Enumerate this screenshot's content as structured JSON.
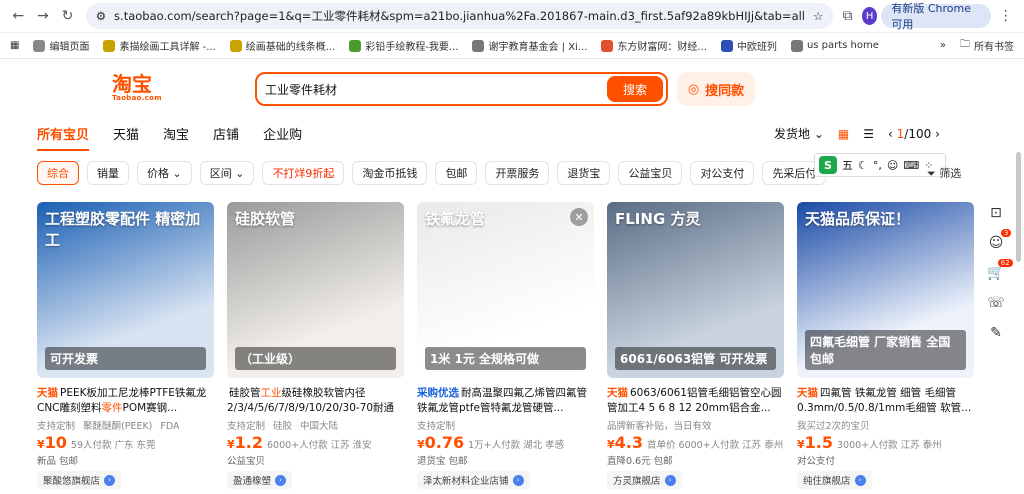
{
  "browser": {
    "url": "s.taobao.com/search?page=1&q=工业零件耗材&spm=a21bo.jianhua%2Fa.201867-main.d3_first.5af92a89kbHIJj&tab=all",
    "avatar_letter": "H",
    "update_label": "有新版 Chrome 可用"
  },
  "bookmarks": [
    "编辑页面",
    "素描绘画工具详解 -...",
    "绘画基础的线条概...",
    "彩铅手绘教程-我要...",
    "谢宇教育基金会 | Xi...",
    "东方财富网：财经...",
    "中欧班列",
    "us parts home"
  ],
  "bookmark_more": "»",
  "bookmark_folder": "所有书签",
  "logo": {
    "cn": "淘宝",
    "en": "Taobao.com"
  },
  "search": {
    "query": "工业零件耗材",
    "button": "搜索",
    "same_pic": "搜同款"
  },
  "tabs": [
    "所有宝贝",
    "天猫",
    "淘宝",
    "店铺",
    "企业购"
  ],
  "tools": {
    "ship_from": "发货地",
    "page": "1",
    "pages": "/100"
  },
  "filters": [
    "综合",
    "销量",
    "价格",
    "区间",
    "不打烊9折起",
    "淘金币抵钱",
    "包邮",
    "开票服务",
    "退货宝",
    "公益宝贝",
    "对公支付",
    "先采后付"
  ],
  "filter_more": "筛选",
  "ime_label": "五",
  "products": [
    {
      "img_text": "工程塑胶零配件 精密加工",
      "img_sub": "可开发票",
      "tag": "天猫",
      "title_a": "PEEK板加工尼龙棒PTFE铁氟龙CNC雕刻塑料",
      "title_hl": "零件",
      "title_b": "POM赛钢...",
      "attrs": [
        "支持定制",
        "聚醚醚酮(PEEK)",
        "FDA"
      ],
      "price": "10",
      "pmeta": "59人付款  广东 东莞",
      "extra": "新品  包邮",
      "shop": "聚酸悠旗舰店",
      "colors": [
        "#1a5fb4",
        "#d9e4f2"
      ]
    },
    {
      "img_text": "硅胶软管",
      "img_sub": "（工业级）",
      "tag": "",
      "title_a": "硅胶管",
      "title_hl": "工业",
      "title_b": "级硅橡胶软管内径2/3/4/5/6/7/8/9/10/20/30-70耐通牌",
      "attrs": [
        "支持定制",
        "硅胶",
        "中国大陆"
      ],
      "price": "1.2",
      "pmeta": "6000+人付款  江苏 淮安",
      "extra": "公益宝贝",
      "shop": "盈通橡塑",
      "colors": [
        "#9a9a9a",
        "#f2efea"
      ]
    },
    {
      "img_text": "铁氟龙管",
      "img_sub": "1米 1元 全规格可做",
      "tag": "采购优选",
      "title_a": "耐高温聚四氟乙烯管四氟管铁氟龙管ptfe管特氟龙管硬管...",
      "title_hl": "",
      "title_b": "",
      "attrs": [
        "支持定制"
      ],
      "price": "0.76",
      "pmeta": "1万+人付款  湖北 孝感",
      "extra": "退货宝  包邮",
      "shop": "泽太新材料企业店铺",
      "colors": [
        "#e9e9e9",
        "#ffffff"
      ]
    },
    {
      "img_text": "FLING 方灵",
      "img_sub": "6061/6063铝管 可开发票",
      "tag": "天猫",
      "title_a": "6063/6061铝管毛细铝管空心圆管加工4 5 6 8 12 20mm铝合金...",
      "title_hl": "",
      "title_b": "",
      "attrs": [
        "品牌新客补贴，当日有效"
      ],
      "price": "4.3",
      "pmeta": "首单价  6000+人付款  江苏 泰州",
      "extra": "直降0.6元  包邮",
      "shop": "方灵旗舰店",
      "colors": [
        "#5a6d85",
        "#c9d3df"
      ]
    },
    {
      "img_text": "天猫品质保证！",
      "img_sub": "四氟毛细管 厂家销售 全国包邮",
      "tag": "天猫",
      "title_a": "四氟管 铁氟龙管 细管 毛细管0.3mm/0.5/0.8/1mm毛细管 软管...",
      "title_hl": "",
      "title_b": "",
      "attrs": [
        "我买过2次的宝贝"
      ],
      "price": "1.5",
      "pmeta": "3000+人付款  江苏 泰州",
      "extra": "对公支付",
      "shop": "纯住旗舰店",
      "colors": [
        "#1a4aa6",
        "#eef3fb"
      ]
    }
  ],
  "side_badges": [
    "3",
    "62"
  ]
}
